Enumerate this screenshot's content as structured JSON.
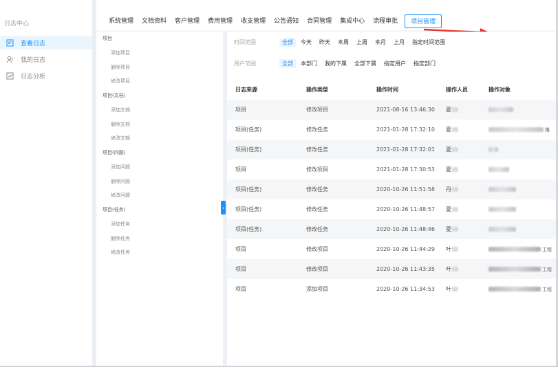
{
  "sidebar": {
    "title": "日志中心",
    "items": [
      {
        "label": "查看日志",
        "icon": "view-log-icon",
        "active": true
      },
      {
        "label": "我的日志",
        "icon": "user-icon",
        "active": false
      },
      {
        "label": "日志分析",
        "icon": "analysis-icon",
        "active": false
      }
    ]
  },
  "topnav": {
    "tabs": [
      "系统管理",
      "文档资料",
      "客户管理",
      "费用管理",
      "收支管理",
      "公告通知",
      "合同管理",
      "集成中心",
      "流程审批",
      "项目管理"
    ],
    "active": "项目管理"
  },
  "tree": [
    {
      "group": "项目",
      "children": [
        "添加项目",
        "删除项目",
        "修改项目"
      ]
    },
    {
      "group": "项目(文档)",
      "children": [
        "添加文档",
        "删除文档",
        "修改文档"
      ]
    },
    {
      "group": "项目(问题)",
      "children": [
        "添加问题",
        "删除问题",
        "修改问题"
      ]
    },
    {
      "group": "项目(任务)",
      "children": [
        "添加任务",
        "删除任务",
        "修改任务"
      ]
    }
  ],
  "filters": {
    "time": {
      "label": "时间范围",
      "options": [
        "全部",
        "今天",
        "昨天",
        "本周",
        "上周",
        "本月",
        "上月",
        "指定时间范围"
      ],
      "selected": "全部"
    },
    "user": {
      "label": "用户范围",
      "options": [
        "全部",
        "本部门",
        "我的下属",
        "全部下属",
        "指定用户",
        "指定部门"
      ],
      "selected": "全部"
    }
  },
  "table": {
    "columns": [
      "日志来源",
      "操作类型",
      "操作时间",
      "操作人员",
      "操作对象"
    ],
    "rows": [
      {
        "source": "项目",
        "type": "修改项目",
        "time": "2021-08-16 13:46:30",
        "user": "夏",
        "object": "",
        "tail": ""
      },
      {
        "source": "项目(任务)",
        "type": "修改任务",
        "time": "2021-01-28 17:32:10",
        "user": "夏",
        "object": "",
        "tail": "推"
      },
      {
        "source": "项目(任务)",
        "type": "修改任务",
        "time": "2021-01-28 17:32:01",
        "user": "夏",
        "object": "",
        "tail": ""
      },
      {
        "source": "项目",
        "type": "修改项目",
        "time": "2021-01-28 17:30:53",
        "user": "夏",
        "object": "",
        "tail": ""
      },
      {
        "source": "项目(任务)",
        "type": "修改任务",
        "time": "2020-10-26 11:51:58",
        "user": "丹",
        "object": "",
        "tail": ""
      },
      {
        "source": "项目(任务)",
        "type": "修改任务",
        "time": "2020-10-26 11:48:57",
        "user": "夏",
        "object": "",
        "tail": ""
      },
      {
        "source": "项目(任务)",
        "type": "修改任务",
        "time": "2020-10-26 11:48:46",
        "user": "夏",
        "object": "",
        "tail": ""
      },
      {
        "source": "项目",
        "type": "修改项目",
        "time": "2020-10-26 11:44:29",
        "user": "叶",
        "object": "",
        "tail": "工程"
      },
      {
        "source": "项目",
        "type": "修改项目",
        "time": "2020-10-26 11:43:35",
        "user": "叶",
        "object": "",
        "tail": "工程"
      },
      {
        "source": "项目",
        "type": "添加项目",
        "time": "2020-10-26 11:34:53",
        "user": "叶",
        "object": "",
        "tail": "工程"
      }
    ]
  },
  "colors": {
    "accent": "#1890ff",
    "annotation_arrow": "#e8322b"
  }
}
